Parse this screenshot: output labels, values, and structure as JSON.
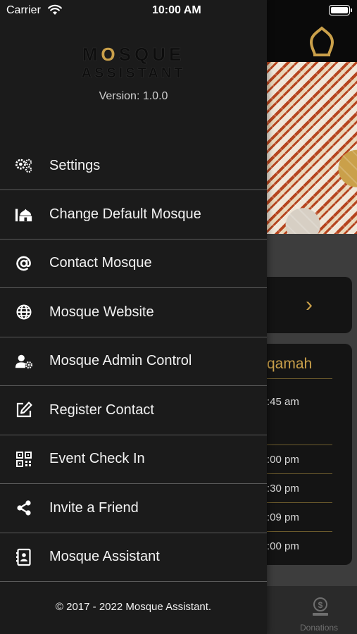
{
  "status_bar": {
    "carrier": "Carrier",
    "time": "10:00 AM"
  },
  "brand": {
    "line1_a": "M",
    "line1_o": "O",
    "line1_b": "SQUE",
    "line2": "ASSISTANT"
  },
  "version": "Version: 1.0.0",
  "menu": [
    {
      "label": "Settings",
      "icon": "gears-icon"
    },
    {
      "label": "Change Default Mosque",
      "icon": "mosque-icon"
    },
    {
      "label": "Contact Mosque",
      "icon": "at-icon"
    },
    {
      "label": "Mosque Website",
      "icon": "globe-icon"
    },
    {
      "label": "Mosque Admin Control",
      "icon": "user-gear-icon"
    },
    {
      "label": "Register Contact",
      "icon": "edit-icon"
    },
    {
      "label": "Event Check In",
      "icon": "qr-code-icon"
    },
    {
      "label": "Invite a Friend",
      "icon": "share-icon"
    },
    {
      "label": "Mosque Assistant",
      "icon": "contact-book-icon"
    }
  ],
  "copyright": "© 2017 - 2022 Mosque Assistant.",
  "background": {
    "prayer_heading": "qamah",
    "times": [
      ":45 am",
      ":00 pm",
      ":30 pm",
      ":09 pm",
      ":00 pm"
    ],
    "footer_tab": "Donations"
  },
  "colors": {
    "accent": "#caa04a",
    "drawer_bg": "#1b1b1b",
    "divider": "#5a5a5a"
  }
}
